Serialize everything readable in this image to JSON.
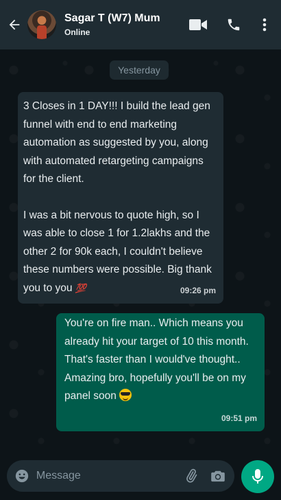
{
  "header": {
    "contact_name": "Sagar T (W7) Mum",
    "status": "Online",
    "icons": [
      "back-arrow-icon",
      "video-call-icon",
      "phone-icon",
      "more-vert-icon"
    ]
  },
  "chat": {
    "date_chip": "Yesterday",
    "incoming": {
      "paragraph1": "3 Closes in 1 DAY!!!  I build the lead gen funnel with end to end marketing automation as suggested by you, along with automated retargeting campaigns for the client.",
      "paragraph2": "I was a bit nervous to quote high, so I was able to close 1 for 1.2lakhs and the other 2 for 90k each, I couldn't believe these numbers were possible. Big thank you to you",
      "emoji": "💯",
      "time": "09:26 pm"
    },
    "outgoing": {
      "line1": "You're on fire man.. Which means you already hit your target of 10 this month. That's faster than I would've thought..",
      "line2": "Amazing bro, hopefully you'll be on my panel soon",
      "emoji": "😎",
      "time": "09:51 pm"
    }
  },
  "composer": {
    "placeholder": "Message",
    "icons": [
      "emoji-icon",
      "attach-icon",
      "camera-icon",
      "mic-icon"
    ]
  },
  "colors": {
    "header_bg": "#1f2c33",
    "chat_bg": "#0d1418",
    "incoming_bubble": "#1f2c33",
    "outgoing_bubble": "#005c4b",
    "accent": "#00a884"
  }
}
